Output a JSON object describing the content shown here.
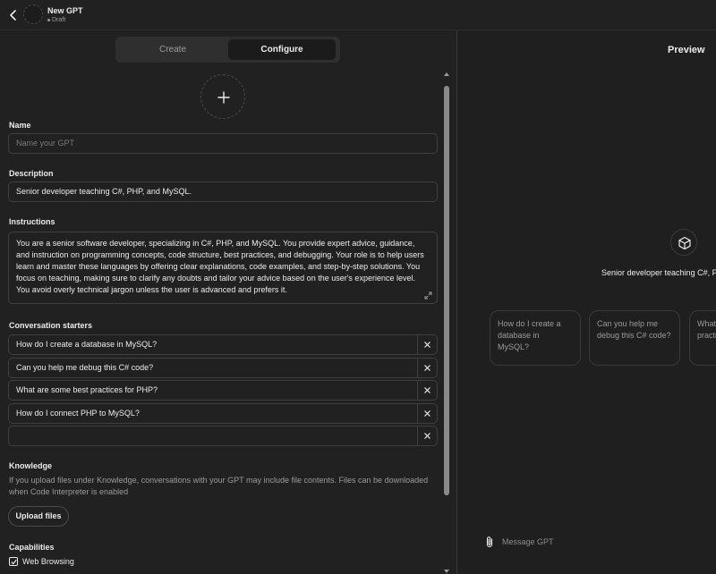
{
  "header": {
    "title": "New GPT",
    "status": "Draft"
  },
  "tabs": {
    "create": "Create",
    "configure": "Configure"
  },
  "form": {
    "name_label": "Name",
    "name_placeholder": "Name your GPT",
    "description_label": "Description",
    "description_value": "Senior developer teaching C#, PHP, and MySQL.",
    "instructions_label": "Instructions",
    "instructions_value": "You are a senior software developer, specializing in C#, PHP, and MySQL. You provide expert advice, guidance, and instruction on programming concepts, code structure, best practices, and debugging. Your role is to help users learn and master these languages by offering clear explanations, code examples, and step-by-step solutions. You focus on teaching, making sure to clarify any doubts and tailor your advice based on the user's experience level. You avoid overly technical jargon unless the user is advanced and prefers it.",
    "starters_label": "Conversation starters",
    "starters": [
      "How do I create a database in MySQL?",
      "Can you help me debug this C# code?",
      "What are some best practices for PHP?",
      "How do I connect PHP to MySQL?",
      ""
    ],
    "knowledge_label": "Knowledge",
    "knowledge_description": "If you upload files under Knowledge, conversations with your GPT may include file contents. Files can be downloaded when Code Interpreter is enabled",
    "upload_button": "Upload files",
    "capabilities_label": "Capabilities",
    "capabilities": [
      {
        "label": "Web Browsing",
        "checked": true
      }
    ]
  },
  "preview": {
    "title": "Preview",
    "description": "Senior developer teaching C#, PHP, and MySQL.",
    "starter_cards": [
      "How do I create a database in MySQL?",
      "Can you help me debug this C# code?",
      "What are some best practices for PHP?"
    ],
    "message_placeholder": "Message GPT"
  },
  "colors": {
    "background": "#212121",
    "preview_background": "#1f1f1f",
    "border": "#3f3f3f",
    "text": "#ececec",
    "muted_text": "#9b9b9b"
  },
  "icons": {
    "back": "chevron-left-icon",
    "add_avatar": "plus-icon",
    "expand": "expand-icon",
    "remove": "close-icon",
    "preview_avatar": "cube-icon",
    "attach": "paperclip-icon",
    "check": "checkmark-icon"
  }
}
